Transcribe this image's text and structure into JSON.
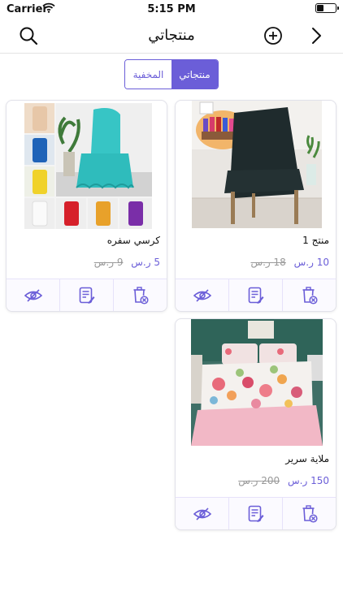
{
  "status": {
    "carrier": "Carrier",
    "time": "5:15 PM",
    "battery_level": 0.35
  },
  "nav": {
    "title": "منتجاتي",
    "icons": [
      "search-icon",
      "add-circle-icon",
      "chevron-right-icon"
    ]
  },
  "segments": {
    "mine": "منتجاتي",
    "hidden": "المخفية",
    "selected": "mine"
  },
  "products": [
    {
      "name": "منتج 1",
      "price": "10 ر.س",
      "old_price": "18 ر.س"
    },
    {
      "name": "كرسي سفره",
      "price": "5 ر.س",
      "old_price": "9 ر.س"
    },
    {
      "name": "ملاية سرير",
      "price": "150 ر.س",
      "old_price": "200 ر.س"
    }
  ],
  "card_actions": [
    "eye-hide-icon",
    "edit-note-icon",
    "delete-icon"
  ],
  "colors": {
    "accent": "#6b5ed8",
    "price_old": "#999999",
    "border": "#e2e2ea"
  }
}
